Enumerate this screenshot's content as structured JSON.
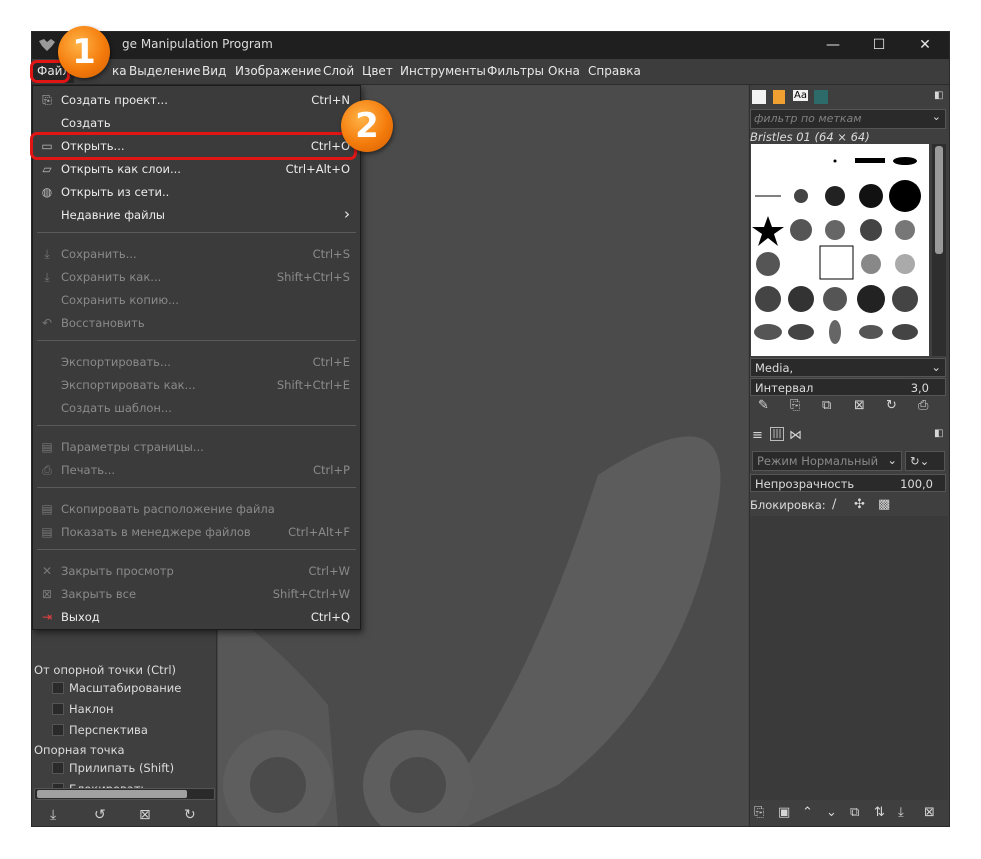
{
  "window": {
    "title": "ge Manipulation Program",
    "controls": {
      "minimize": "—",
      "maximize": "☐",
      "close": "✕"
    }
  },
  "menubar": [
    "Файл",
    "ка",
    "Выделение",
    "Вид",
    "Изображение",
    "Слой",
    "Цвет",
    "Инструменты",
    "Фильтры",
    "Окна",
    "Справка"
  ],
  "file_menu": {
    "items": [
      {
        "label": "Создать проект...",
        "shortcut": "Ctrl+N",
        "icon": "new-project-icon"
      },
      {
        "label": "Создать",
        "shortcut": "",
        "icon": ""
      },
      {
        "label": "Открыть...",
        "shortcut": "Ctrl+O",
        "icon": "open-icon"
      },
      {
        "label": "Открыть как слои...",
        "shortcut": "Ctrl+Alt+O",
        "icon": "open-as-layers-icon"
      },
      {
        "label": "Открыть из сети..",
        "shortcut": "",
        "icon": "globe-icon"
      },
      {
        "label": "Недавние файлы",
        "shortcut": "",
        "icon": "",
        "submenu": "›"
      },
      {
        "label": "Сохранить...",
        "shortcut": "Ctrl+S",
        "icon": "save-icon"
      },
      {
        "label": "Сохранить как...",
        "shortcut": "Shift+Ctrl+S",
        "icon": "save-as-icon"
      },
      {
        "label": "Сохранить копию...",
        "shortcut": "",
        "icon": ""
      },
      {
        "label": "Восстановить",
        "shortcut": "",
        "icon": "revert-icon"
      },
      {
        "label": "Экспортировать...",
        "shortcut": "Ctrl+E",
        "icon": ""
      },
      {
        "label": "Экспортировать как...",
        "shortcut": "Shift+Ctrl+E",
        "icon": ""
      },
      {
        "label": "Создать шаблон...",
        "shortcut": "",
        "icon": ""
      },
      {
        "label": "Параметры страницы...",
        "shortcut": "",
        "icon": "page-setup-icon"
      },
      {
        "label": "Печать...",
        "shortcut": "Ctrl+P",
        "icon": "print-icon"
      },
      {
        "label": "Скопировать расположение файла",
        "shortcut": "",
        "icon": "copy-location-icon"
      },
      {
        "label": "Показать в менеджере файлов",
        "shortcut": "Ctrl+Alt+F",
        "icon": "file-manager-icon"
      },
      {
        "label": "Закрыть просмотр",
        "shortcut": "Ctrl+W",
        "icon": "close-view-icon"
      },
      {
        "label": "Закрыть все",
        "shortcut": "Shift+Ctrl+W",
        "icon": "close-all-icon"
      },
      {
        "label": "Выход",
        "shortcut": "Ctrl+Q",
        "icon": "quit-icon"
      }
    ]
  },
  "tool_options": {
    "pivot_label": "От опорной точки  (Ctrl)",
    "scale": "Масштабирование",
    "shear": "Наклон",
    "perspective": "Перспектива",
    "pivot_point": "Опорная точка",
    "snap": "Прилипать (Shift)",
    "lock": "Блокировать"
  },
  "brushes": {
    "filter_placeholder": "фильтр по меткам",
    "current_brush": "Bristles 01 (64 × 64)",
    "tag": "Media,",
    "spacing_label": "Интервал",
    "spacing_value": "3,0"
  },
  "layers": {
    "mode_label": "Режим",
    "mode_value": "Нормальный",
    "opacity_label": "Непрозрачность",
    "opacity_value": "100,0",
    "lock_label": "Блокировка:"
  },
  "annotations": {
    "badge1": "1",
    "badge2": "2"
  },
  "colors": {
    "highlight": "#e21515",
    "badge": "#f47c0c"
  }
}
